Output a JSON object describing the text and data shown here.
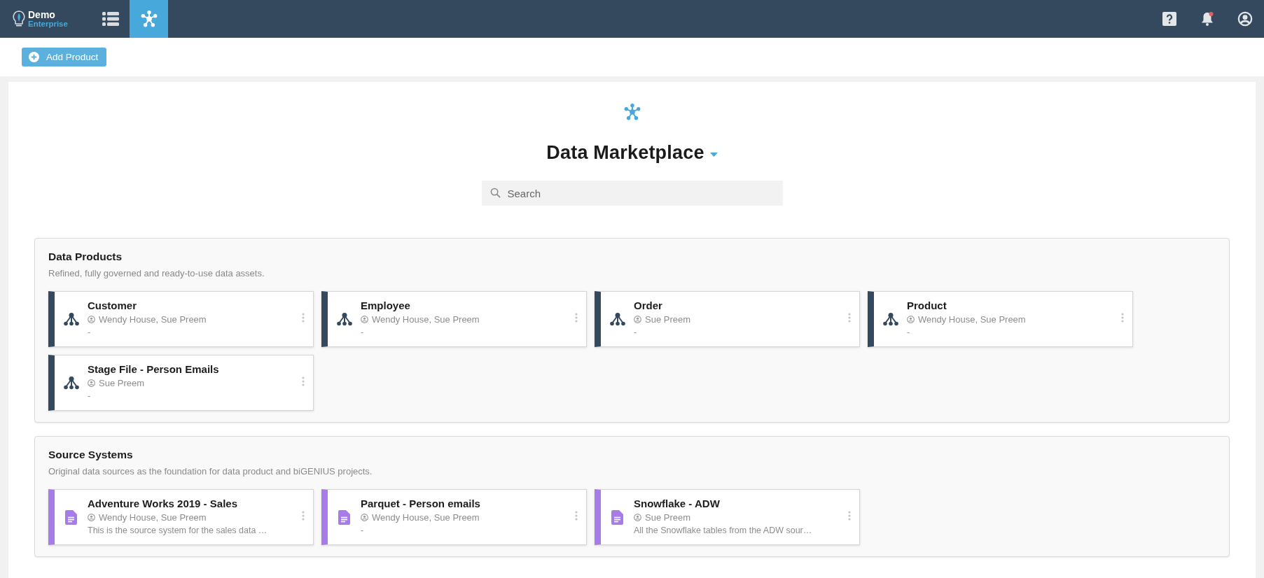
{
  "brand": {
    "name": "Demo",
    "edition": "Enterprise"
  },
  "nav": [
    {
      "kind": "list",
      "selected": false
    },
    {
      "kind": "network",
      "selected": true
    }
  ],
  "header_actions": {
    "notifications_unread": true
  },
  "toolbar": {
    "add_button": "Add Product"
  },
  "marketplace": {
    "title": "Data Marketplace",
    "search": {
      "placeholder": "Search"
    }
  },
  "sections": [
    {
      "title": "Data Products",
      "subtitle": "Refined, fully governed and ready-to-use data assets.",
      "cards": [
        {
          "kind": "product",
          "name": "Customer",
          "owners": "Wendy House, Sue Preem",
          "description": "-"
        },
        {
          "kind": "product",
          "name": "Employee",
          "owners": "Wendy House, Sue Preem",
          "description": "-"
        },
        {
          "kind": "product",
          "name": "Order",
          "owners": "Sue Preem",
          "description": "-"
        },
        {
          "kind": "product",
          "name": "Product",
          "owners": "Wendy House, Sue Preem",
          "description": "-"
        },
        {
          "kind": "product",
          "name": "Stage File - Person Emails",
          "owners": "Sue Preem",
          "description": "-"
        }
      ]
    },
    {
      "title": "Source Systems",
      "subtitle": "Original data sources as the foundation for data product and biGENIUS projects.",
      "cards": [
        {
          "kind": "source",
          "name": "Adventure Works 2019 - Sales",
          "owners": "Wendy House, Sue Preem",
          "description": "This is the source system for the sales data …"
        },
        {
          "kind": "source",
          "name": "Parquet - Person emails",
          "owners": "Wendy House, Sue Preem",
          "description": "-"
        },
        {
          "kind": "source",
          "name": "Snowflake - ADW",
          "owners": "Sue Preem",
          "description": "All the Snowflake tables from the ADW sour…"
        }
      ]
    }
  ]
}
